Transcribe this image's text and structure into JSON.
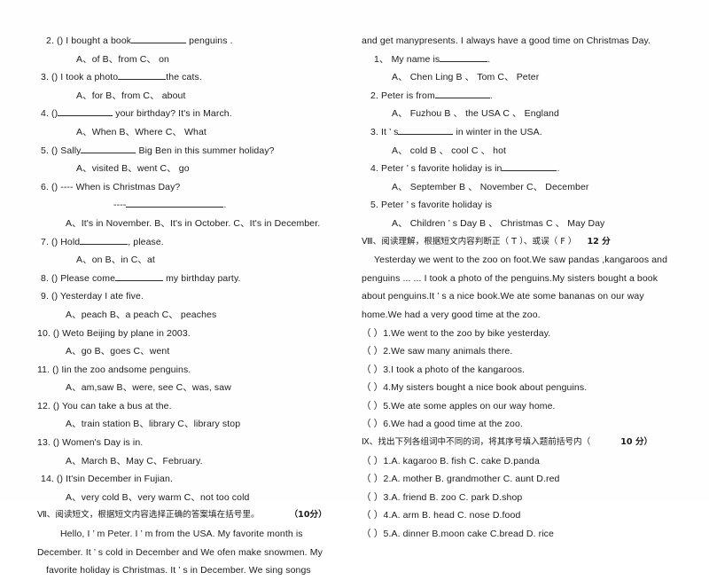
{
  "document": {
    "type": "english-exam-paper",
    "language": "en-zh"
  },
  "left_column": {
    "questions": [
      {
        "num": "2. (",
        "close": ")",
        "stem_pre": "I bought a book",
        "stem_post": "penguins .",
        "options": "A、of  B、from   C、  on"
      },
      {
        "num": "3. (",
        "close": ")",
        "stem_pre": "I took a photo",
        "stem_post": "the cats.",
        "options": "A、for  B、from   C、  about"
      },
      {
        "num": "4. (",
        "close": ")",
        "stem_pre": "",
        "stem_post": "your birthday?   It's in March.",
        "options": "A、When  B、Where  C、   What"
      },
      {
        "num": "5. (",
        "close": ")",
        "stem_pre": "Sally",
        "stem_post": "Big Ben in this summer holiday?",
        "options": "A、visited  B、went  C、  go"
      },
      {
        "num": "6. (",
        "close": ")",
        "stem_pre": "---- When is Christmas Day?",
        "stem_post": "",
        "sub_line": "----",
        "options": "A、It's in November.    B、It's in October.       C、It's in December."
      },
      {
        "num": "7. (",
        "close": ")",
        "stem_pre": "Hold",
        "stem_post": ", please.",
        "options": "A、on  B、in   C、at"
      },
      {
        "num": "8. (",
        "close": ")",
        "stem_pre": "Please come",
        "stem_post": "my birthday party.",
        "options": ""
      },
      {
        "num": "9.  (",
        "close": ")",
        "stem_pre": "Yesterday I ate five",
        "stem_post": ".",
        "options": "A、peach   B、a peach   C、 peaches"
      },
      {
        "num": "10.  (",
        "close": ")",
        "stem_pre": "We",
        "stem_post": "to Beijing   by plane in 2003.",
        "options": "A、go  B、goes  C、went"
      },
      {
        "num": "11.  (",
        "close": ")",
        "stem_pre": "I",
        "stem_post": "some penguins.",
        "stem_mid": "in the zoo and",
        "options": "A、am,saw  B、were, see  C、was, saw"
      },
      {
        "num": "12.  (",
        "close": ")",
        "stem_pre": "You can take a bus at the",
        "stem_post": ".",
        "options": "A、train station  B、library   C、library stop"
      },
      {
        "num": "13.  (",
        "close": ")",
        "stem_pre": "Women's Day is in",
        "stem_post": ".",
        "options": "A、March    B、May     C、February."
      },
      {
        "num": "14.  (",
        "close": ")",
        "stem_pre": "It's",
        "stem_post": "in December in Fujian.",
        "options": "A、very cold  B、very warm   C、not too cold"
      }
    ],
    "section_vii": {
      "heading": "Ⅶ、阅读短文，根据短文内容选择正确的答案填在括号里。",
      "points": "（10分）"
    },
    "passage_lines": [
      "Hello, I  ’  m Peter. I  ’  m from the USA. My favorite month is",
      "December. It  ’  s cold in December and We ofen make snowmen. My",
      "favorite holiday is Christmas. It            ’  s in December. We sing songs"
    ]
  },
  "right_column": {
    "passage_tail": "and get  manypresents.   I  always  have a good time  on Christmas   Day.",
    "comprehension_questions": [
      {
        "num": "1、",
        "stem_pre": "My name is",
        "stem_post": ".",
        "options": "A、 Chen Ling  B 、 Tom  C、 Peter"
      },
      {
        "num": "2.",
        "stem_pre": "Peter is from",
        "stem_post": ".",
        "options": "A、 Fuzhou  B 、 the USA  C 、 England"
      },
      {
        "num": "3.",
        "stem_pre": "It ’ s",
        "stem_post": "in winter in the USA.",
        "options": "A、 cold  B 、 cool  C 、 hot"
      },
      {
        "num": "4.",
        "stem_pre": "Peter ’ s favorite  holiday is in",
        "stem_post": ".",
        "options": "A、 September  B 、 November C、 December"
      },
      {
        "num": "5.",
        "stem_pre": "Peter ’ s favorite  holiday is",
        "stem_post": "",
        "options": "A、 Children ’ s Day  B 、 Christmas C 、 May Day"
      }
    ],
    "section_viii": {
      "heading": "Ⅷ、阅读理解，根据短文内容判断正（    T ）、或误（ F ）",
      "points": "12 分"
    },
    "reading_passage": [
      "Yesterday  we went to  the  zoo on foot.We  saw pandas ,kangaroos   and",
      "penguins ... ...  I   took  a photo  of  the  penguins.My  sisters    bought  a book",
      "about penguins.It     ’  s a nice book.We ate some bananas  on our way",
      "home.We had a very good time at the zoo."
    ],
    "true_false_items": [
      "（ ）1.We went to the zoo by bike yesterday.",
      "（ ）2.We saw many animals there.",
      "（ ）3.I took a photo of the kangaroos.",
      "（ ）4.My sisters bought a nice book about penguins.",
      "（ ）5.We ate some apples on our way home.",
      "（ ）6.We had a good time at the zoo."
    ],
    "section_ix": {
      "heading": "Ⅸ、找出下列各组词中不同的词，将其序号填入题前括号内（",
      "points": "10 分）"
    },
    "odd_one_out": [
      {
        "paren": "（    ）",
        "text": "1.A. kagaroo      B. fish       C. cake    D.panda"
      },
      {
        "paren": "（    ）",
        "text": "2.A. mother      B. grandmother C. aunt     D.red"
      },
      {
        "paren": "（    ）",
        "text": "3.A. friend      B. zoo       C. park   D.shop"
      },
      {
        "paren": "（    ）",
        "text": "4.A. arm       B. head     C. nose    D.food"
      },
      {
        "paren": "（    ）",
        "text": "5.A. dinner       B.moon cake   C.bread    D. rice"
      }
    ]
  }
}
